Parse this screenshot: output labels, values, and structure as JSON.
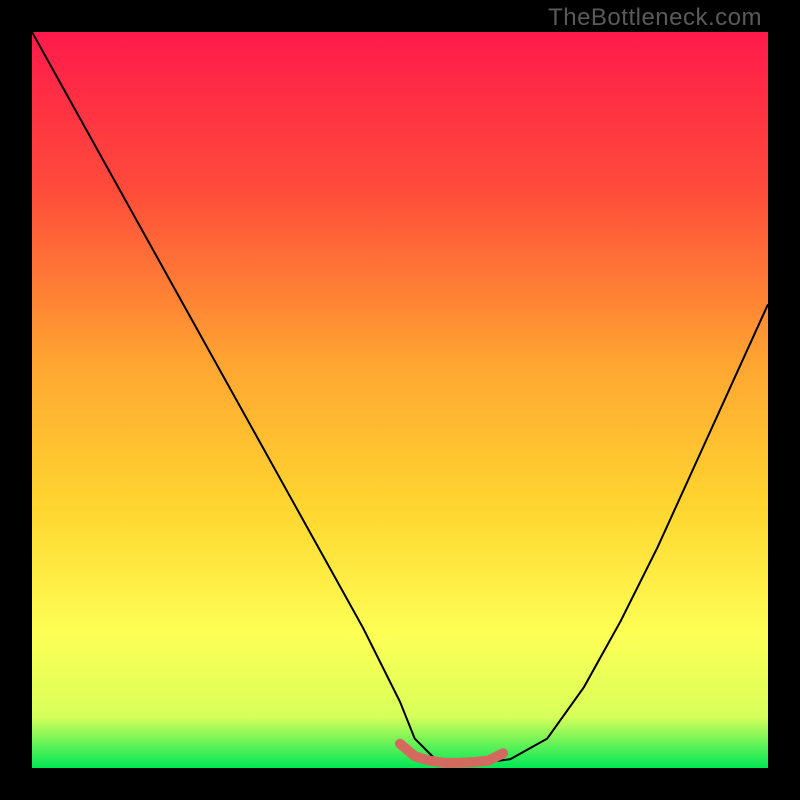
{
  "watermark": "TheBottleneck.com",
  "chart_data": {
    "type": "line",
    "title": "",
    "xlabel": "",
    "ylabel": "",
    "xlim": [
      0,
      100
    ],
    "ylim": [
      0,
      100
    ],
    "gradient_stops": [
      {
        "offset": 0,
        "color": "#ff1a4b"
      },
      {
        "offset": 0.22,
        "color": "#ff4d3a"
      },
      {
        "offset": 0.45,
        "color": "#ffa531"
      },
      {
        "offset": 0.65,
        "color": "#ffd730"
      },
      {
        "offset": 0.82,
        "color": "#fdff55"
      },
      {
        "offset": 0.93,
        "color": "#d8ff5a"
      },
      {
        "offset": 1.0,
        "color": "#00e756"
      }
    ],
    "series": [
      {
        "name": "bottleneck-curve",
        "color": "#000000",
        "stroke_width": 2,
        "x": [
          0,
          5,
          10,
          15,
          20,
          25,
          30,
          35,
          40,
          45,
          50,
          52,
          55,
          58,
          60,
          62,
          65,
          70,
          75,
          80,
          85,
          90,
          95,
          100
        ],
        "values": [
          100,
          91,
          82,
          73,
          64,
          55,
          46,
          37,
          28,
          19,
          9,
          4,
          1,
          0.7,
          0.7,
          0.8,
          1.2,
          4,
          11,
          20,
          30,
          41,
          52,
          63
        ]
      },
      {
        "name": "sweet-spot-marker",
        "color": "#d46a5f",
        "stroke_width": 10,
        "linecap": "round",
        "x": [
          50,
          52,
          54,
          56,
          58,
          60,
          62,
          64
        ],
        "values": [
          3.3,
          1.6,
          1.0,
          0.7,
          0.7,
          0.8,
          1.0,
          2.0
        ]
      }
    ]
  }
}
